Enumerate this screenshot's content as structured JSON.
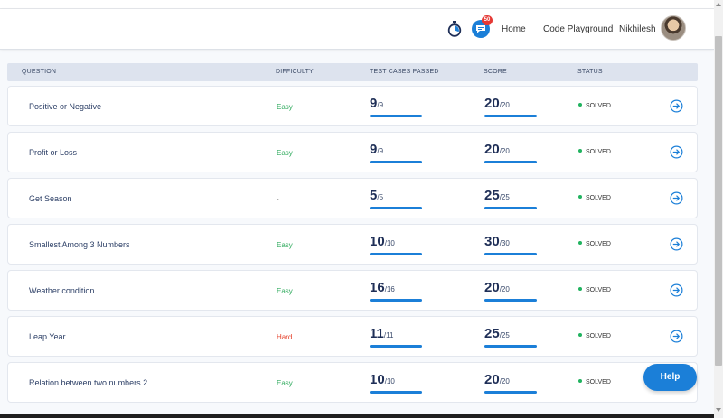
{
  "nav": {
    "badge_count": "50",
    "home": "Home",
    "code_playground": "Code Playground",
    "user_name": "Nikhilesh"
  },
  "table": {
    "headers": {
      "question": "QUESTION",
      "difficulty": "DIFFICULTY",
      "test_cases": "TEST CASES PASSED",
      "score": "SCORE",
      "status": "STATUS"
    },
    "rows": [
      {
        "question": "Positive or Negative",
        "difficulty": "Easy",
        "level": "easy",
        "tc_passed": "9",
        "tc_total": "/9",
        "score": "20",
        "score_total": "/20",
        "status": "SOLVED"
      },
      {
        "question": "Profit or Loss",
        "difficulty": "Easy",
        "level": "easy",
        "tc_passed": "9",
        "tc_total": "/9",
        "score": "20",
        "score_total": "/20",
        "status": "SOLVED"
      },
      {
        "question": "Get Season",
        "difficulty": "-",
        "level": "none",
        "tc_passed": "5",
        "tc_total": "/5",
        "score": "25",
        "score_total": "/25",
        "status": "SOLVED"
      },
      {
        "question": "Smallest Among 3 Numbers",
        "difficulty": "Easy",
        "level": "easy",
        "tc_passed": "10",
        "tc_total": "/10",
        "score": "30",
        "score_total": "/30",
        "status": "SOLVED"
      },
      {
        "question": "Weather condition",
        "difficulty": "Easy",
        "level": "easy",
        "tc_passed": "16",
        "tc_total": "/16",
        "score": "20",
        "score_total": "/20",
        "status": "SOLVED"
      },
      {
        "question": "Leap Year",
        "difficulty": "Hard",
        "level": "hard",
        "tc_passed": "11",
        "tc_total": "/11",
        "score": "25",
        "score_total": "/25",
        "status": "SOLVED"
      },
      {
        "question": "Relation between two numbers 2",
        "difficulty": "Easy",
        "level": "easy",
        "tc_passed": "10",
        "tc_total": "/10",
        "score": "20",
        "score_total": "/20",
        "status": "SOLVED"
      }
    ]
  },
  "help_button": "Help",
  "icons": {
    "timer": "stopwatch-icon",
    "chat": "chat-icon",
    "row_action": "arrow-circle-right-icon"
  },
  "colors": {
    "accent": "#1b7fd8",
    "easy": "#2eaa5c",
    "hard": "#e5412b",
    "solved_dot": "#21b35f",
    "header_bg": "#dde3ee",
    "text_dark": "#1f2f57"
  }
}
